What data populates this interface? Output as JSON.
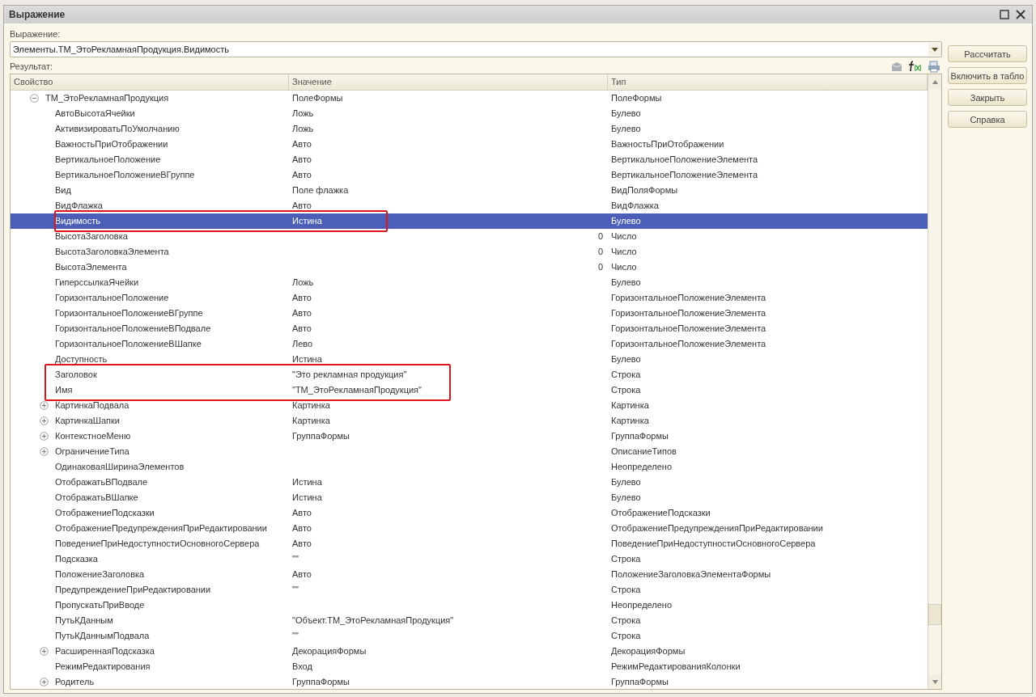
{
  "window": {
    "title": "Выражение"
  },
  "expression": {
    "label": "Выражение:",
    "value": "Элементы.ТМ_ЭтоРекламнаяПродукция.Видимость"
  },
  "result": {
    "label": "Результат:"
  },
  "buttons": [
    "Рассчитать",
    "Включить в табло",
    "Закрыть",
    "Справка"
  ],
  "table": {
    "columns": [
      "Свойство",
      "Значение",
      "Тип"
    ],
    "rows": [
      {
        "kind": "node",
        "expanded": true,
        "selected": false,
        "framed": false,
        "property": "ТМ_ЭтоРекламнаяПродукция",
        "value": "ПолеФормы",
        "type": "ПолеФормы",
        "children": [
          {
            "kind": "leaf",
            "selected": false,
            "framed": false,
            "property": "АвтоВысотаЯчейки",
            "value": "Ложь",
            "type": "Булево"
          },
          {
            "kind": "leaf",
            "selected": false,
            "framed": false,
            "property": "АктивизироватьПоУмолчанию",
            "value": "Ложь",
            "type": "Булево"
          },
          {
            "kind": "leaf",
            "selected": false,
            "framed": false,
            "property": "ВажностьПриОтображении",
            "value": "Авто",
            "type": "ВажностьПриОтображении"
          },
          {
            "kind": "leaf",
            "selected": false,
            "framed": false,
            "property": "ВертикальноеПоложение",
            "value": "Авто",
            "type": "ВертикальноеПоложениеЭлемента"
          },
          {
            "kind": "leaf",
            "selected": false,
            "framed": false,
            "property": "ВертикальноеПоложениеВГруппе",
            "value": "Авто",
            "type": "ВертикальноеПоложениеЭлемента"
          },
          {
            "kind": "leaf",
            "selected": false,
            "framed": false,
            "property": "Вид",
            "value": "Поле флажка",
            "type": "ВидПоляФормы"
          },
          {
            "kind": "leaf",
            "selected": false,
            "framed": false,
            "property": "ВидФлажка",
            "value": "Авто",
            "type": "ВидФлажка"
          },
          {
            "kind": "leaf",
            "selected": true,
            "framed": true,
            "property": "Видимость",
            "value": "Истина",
            "type": "Булево"
          },
          {
            "kind": "number",
            "selected": false,
            "framed": false,
            "property": "ВысотаЗаголовка",
            "value": "0",
            "type": "Число"
          },
          {
            "kind": "number",
            "selected": false,
            "framed": false,
            "property": "ВысотаЗаголовкаЭлемента",
            "value": "0",
            "type": "Число"
          },
          {
            "kind": "number",
            "selected": false,
            "framed": false,
            "property": "ВысотаЭлемента",
            "value": "0",
            "type": "Число"
          },
          {
            "kind": "leaf",
            "selected": false,
            "framed": false,
            "property": "ГиперссылкаЯчейки",
            "value": "Ложь",
            "type": "Булево"
          },
          {
            "kind": "leaf",
            "selected": false,
            "framed": false,
            "property": "ГоризонтальноеПоложение",
            "value": "Авто",
            "type": "ГоризонтальноеПоложениеЭлемента"
          },
          {
            "kind": "leaf",
            "selected": false,
            "framed": false,
            "property": "ГоризонтальноеПоложениеВГруппе",
            "value": "Авто",
            "type": "ГоризонтальноеПоложениеЭлемента"
          },
          {
            "kind": "leaf",
            "selected": false,
            "framed": false,
            "property": "ГоризонтальноеПоложениеВПодвале",
            "value": "Авто",
            "type": "ГоризонтальноеПоложениеЭлемента"
          },
          {
            "kind": "leaf",
            "selected": false,
            "framed": false,
            "property": "ГоризонтальноеПоложениеВШапке",
            "value": "Лево",
            "type": "ГоризонтальноеПоложениеЭлемента"
          },
          {
            "kind": "leaf",
            "selected": false,
            "framed": false,
            "property": "Доступность",
            "value": "Истина",
            "type": "Булево"
          },
          {
            "kind": "leaf",
            "selected": false,
            "framed": true,
            "property": "Заголовок",
            "value": "\"Это рекламная продукция\"",
            "type": "Строка"
          },
          {
            "kind": "leaf",
            "selected": false,
            "framed": true,
            "property": "Имя",
            "value": "\"ТМ_ЭтоРекламнаяПродукция\"",
            "type": "Строка"
          },
          {
            "kind": "node",
            "expanded": false,
            "selected": false,
            "framed": false,
            "property": "КартинкаПодвала",
            "value": "Картинка",
            "type": "Картинка"
          },
          {
            "kind": "node",
            "expanded": false,
            "selected": false,
            "framed": false,
            "property": "КартинкаШапки",
            "value": "Картинка",
            "type": "Картинка"
          },
          {
            "kind": "node",
            "expanded": false,
            "selected": false,
            "framed": false,
            "property": "КонтекстноеМеню",
            "value": "ГруппаФормы",
            "type": "ГруппаФормы"
          },
          {
            "kind": "node",
            "expanded": false,
            "selected": false,
            "framed": false,
            "property": "ОграничениеТипа",
            "type": "ОписаниеТипов"
          },
          {
            "kind": "leaf",
            "selected": false,
            "framed": false,
            "property": "ОдинаковаяШиринаЭлементов",
            "type": "Неопределено"
          },
          {
            "kind": "leaf",
            "selected": false,
            "framed": false,
            "property": "ОтображатьВПодвале",
            "value": "Истина",
            "type": "Булево"
          },
          {
            "kind": "leaf",
            "selected": false,
            "framed": false,
            "property": "ОтображатьВШапке",
            "value": "Истина",
            "type": "Булево"
          },
          {
            "kind": "leaf",
            "selected": false,
            "framed": false,
            "property": "ОтображениеПодсказки",
            "value": "Авто",
            "type": "ОтображениеПодсказки"
          },
          {
            "kind": "leaf",
            "selected": false,
            "framed": false,
            "property": "ОтображениеПредупрежденияПриРедактировании",
            "value": "Авто",
            "type": "ОтображениеПредупрежденияПриРедактировании"
          },
          {
            "kind": "leaf",
            "selected": false,
            "framed": false,
            "property": "ПоведениеПриНедоступностиОсновногоСервера",
            "value": "Авто",
            "type": "ПоведениеПриНедоступностиОсновногоСервера"
          },
          {
            "kind": "leaf",
            "selected": false,
            "framed": false,
            "property": "Подсказка",
            "value": "\"\"",
            "type": "Строка"
          },
          {
            "kind": "leaf",
            "selected": false,
            "framed": false,
            "property": "ПоложениеЗаголовка",
            "value": "Авто",
            "type": "ПоложениеЗаголовкаЭлементаФормы"
          },
          {
            "kind": "leaf",
            "selected": false,
            "framed": false,
            "property": "ПредупреждениеПриРедактировании",
            "value": "\"\"",
            "type": "Строка"
          },
          {
            "kind": "leaf",
            "selected": false,
            "framed": false,
            "property": "ПропускатьПриВводе",
            "type": "Неопределено"
          },
          {
            "kind": "leaf",
            "selected": false,
            "framed": false,
            "property": "ПутьКДанным",
            "value": "\"Объект.ТМ_ЭтоРекламнаяПродукция\"",
            "type": "Строка"
          },
          {
            "kind": "leaf",
            "selected": false,
            "framed": false,
            "property": "ПутьКДаннымПодвала",
            "value": "\"\"",
            "type": "Строка"
          },
          {
            "kind": "node",
            "expanded": false,
            "selected": false,
            "framed": false,
            "property": "РасширеннаяПодсказка",
            "value": "ДекорацияФормы",
            "type": "ДекорацияФормы"
          },
          {
            "kind": "leaf",
            "selected": false,
            "framed": false,
            "property": "РежимРедактирования",
            "value": "Вход",
            "type": "РежимРедактированияКолонки"
          },
          {
            "kind": "node",
            "expanded": false,
            "selected": false,
            "framed": false,
            "property": "Родитель",
            "value": "ГруппаФормы",
            "type": "ГруппаФормы"
          }
        ]
      }
    ]
  }
}
